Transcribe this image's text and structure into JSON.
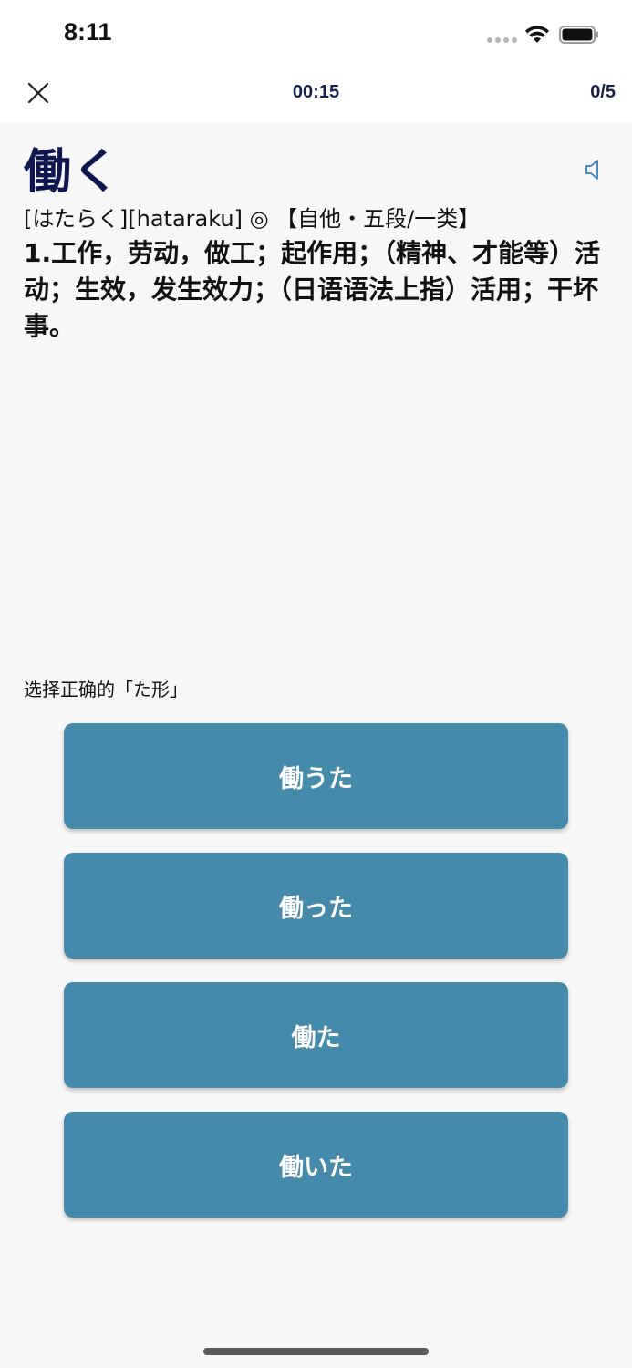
{
  "status_bar": {
    "time": "8:11",
    "icons": [
      "signal-dots-icon",
      "wifi-icon",
      "battery-icon"
    ]
  },
  "nav": {
    "close_icon": "close-icon",
    "timer": "00:15",
    "progress": "0/5"
  },
  "card": {
    "word": "働く",
    "reading": "[はたらく][hataraku] ◎ 【自他・五段/一类】",
    "meaning": "1.工作，劳动，做工；起作用；（精神、才能等）活动；生效，发生效力；（日语语法上指）活用；干坏事。",
    "speaker_icon": "speaker-icon"
  },
  "quiz": {
    "prompt": "选择正确的「た形」",
    "options": [
      {
        "label": "働うた"
      },
      {
        "label": "働った"
      },
      {
        "label": "働た"
      },
      {
        "label": "働いた"
      }
    ]
  },
  "colors": {
    "accent_dark": "#0f1650",
    "option_bg": "#468aab",
    "speaker": "#2f80c4",
    "background": "#f7f7f7"
  }
}
